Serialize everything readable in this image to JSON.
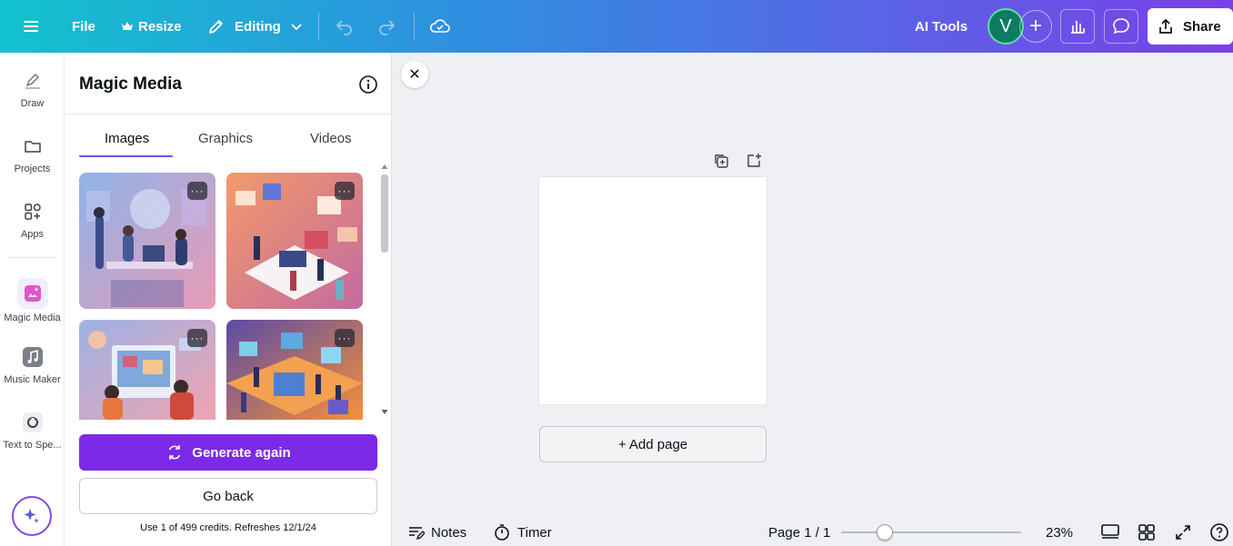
{
  "topbar": {
    "file_label": "File",
    "resize_label": "Resize",
    "editing_label": "Editing",
    "ai_tools_label": "AI Tools",
    "avatar_initial": "V",
    "share_label": "Share"
  },
  "rail": {
    "items": [
      {
        "label": "Draw",
        "icon": "pen-icon"
      },
      {
        "label": "Projects",
        "icon": "folder-icon"
      },
      {
        "label": "Apps",
        "icon": "apps-grid-icon"
      },
      {
        "label": "Magic Media",
        "icon": "magic-media-icon"
      },
      {
        "label": "Music Maker",
        "icon": "music-note-icon"
      },
      {
        "label": "Text to Spe...",
        "icon": "speech-icon"
      }
    ]
  },
  "panel": {
    "title": "Magic Media",
    "tabs": [
      {
        "label": "Images",
        "active": true
      },
      {
        "label": "Graphics",
        "active": false
      },
      {
        "label": "Videos",
        "active": false
      }
    ],
    "thumb_more": "···",
    "generate_again_label": "Generate again",
    "go_back_label": "Go back",
    "credits_text": "Use 1 of 499 credits. Refreshes 12/1/24"
  },
  "canvas": {
    "close_label": "✕",
    "add_page_label": "+ Add page"
  },
  "bottombar": {
    "notes_label": "Notes",
    "timer_label": "Timer",
    "page_indicator": "Page 1 / 1",
    "zoom_level": "23%",
    "zoom_fraction": 0.24
  },
  "colors": {
    "accent_purple": "#7d2ae8",
    "tab_underline": "#7d4be6",
    "avatar_bg": "#0e7a63"
  }
}
